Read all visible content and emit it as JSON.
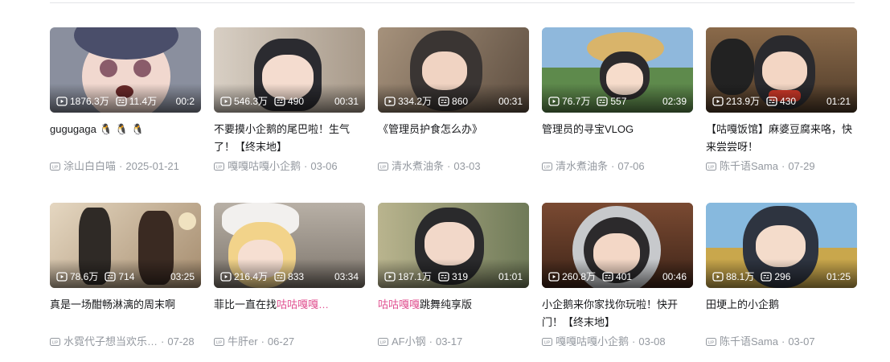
{
  "videos_row1": [
    {
      "plays": "1876.3万",
      "comments": "11.4万",
      "duration": "00:2",
      "title": "gugugaga 🐧 🐧 🐧",
      "title_hl": "",
      "title_rest": "",
      "uploader": "涂山白白喵",
      "date": "2025-01-21",
      "bg": "#8a8f9e"
    },
    {
      "plays": "546.3万",
      "comments": "490",
      "duration": "00:31",
      "title": "不要摸小企鹅的尾巴啦！生气了！【终末地】",
      "title_hl": "",
      "title_rest": "",
      "uploader": "嘎嘎咕嘎小企鹅",
      "date": "03-06",
      "bg": "#b9aa98"
    },
    {
      "plays": "334.2万",
      "comments": "860",
      "duration": "00:31",
      "title": "《管理员护食怎么办》",
      "title_hl": "",
      "title_rest": "",
      "uploader": "清水煮油条",
      "date": "03-03",
      "bg": "#8c7c6c"
    },
    {
      "plays": "76.7万",
      "comments": "557",
      "duration": "02:39",
      "title": "管理员的寻宝VLOG",
      "title_hl": "",
      "title_rest": "",
      "uploader": "清水煮油条",
      "date": "07-06",
      "bg": "#7fa8c9"
    },
    {
      "plays": "213.9万",
      "comments": "430",
      "duration": "01:21",
      "title": "【咕嘎饭馆】麻婆豆腐来咯，快来尝尝呀！",
      "title_hl": "",
      "title_rest": "",
      "uploader": "陈千语Sama",
      "date": "07-29",
      "bg": "#7a5b3e"
    }
  ],
  "videos_row2": [
    {
      "plays": "78.6万",
      "comments": "714",
      "duration": "03:25",
      "title": "真是一场酣畅淋漓的周末啊",
      "title_hl": "",
      "title_rest": "",
      "uploader": "水霓代子想当欢乐…",
      "date": "07-28",
      "bg": "#c9b59a"
    },
    {
      "plays": "216.4万",
      "comments": "833",
      "duration": "03:34",
      "title": "菲比一直在找",
      "title_hl": "咕咕嘎嘎…",
      "title_rest": "",
      "uploader": "牛肝er",
      "date": "06-27",
      "bg": "#9d958d"
    },
    {
      "plays": "187.1万",
      "comments": "319",
      "duration": "01:01",
      "title": "",
      "title_hl": "咕咕嘎嘎",
      "title_rest": "跳舞纯享版",
      "uploader": "AF小钢",
      "date": "03-17",
      "bg": "#8e9a7a"
    },
    {
      "plays": "260.8万",
      "comments": "401",
      "duration": "00:46",
      "title": "小企鹅来你家找你玩啦！快开门！【终末地】",
      "title_hl": "",
      "title_rest": "",
      "uploader": "嘎嘎咕嘎小企鹅",
      "date": "03-08",
      "bg": "#6b3f2a"
    },
    {
      "plays": "88.1万",
      "comments": "296",
      "duration": "01:25",
      "title": "田埂上的小企鹅",
      "title_hl": "",
      "title_rest": "",
      "uploader": "陈千语Sama",
      "date": "03-07",
      "bg": "#86b6d8"
    }
  ],
  "icons": {
    "play": "play-count-icon",
    "comment": "danmaku-count-icon",
    "up": "uploader-badge-icon"
  },
  "colors": {
    "highlight": "#e04f8f",
    "meta": "#9499a0"
  }
}
